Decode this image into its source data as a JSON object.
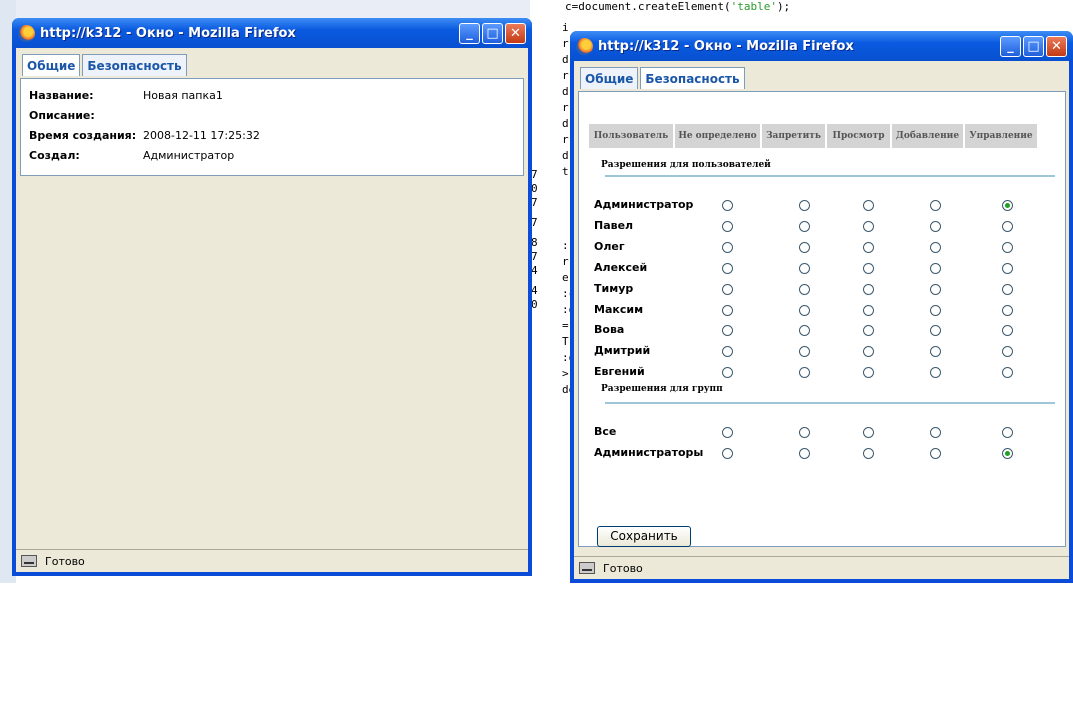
{
  "background": {
    "code_top": "c=document.createElement('table');",
    "code_fragment_prefix": "c=document.createElement(",
    "code_fragment_string": "'table'",
    "code_fragment_suffix": ");",
    "code_lines": [
      "i",
      "r",
      "d",
      "r",
      "d",
      "r",
      "d",
      "r",
      "d",
      "t'"
    ],
    "code_lines_lower": [
      ":",
      "r",
      "e",
      ":c",
      "",
      "",
      ":o",
      "=",
      "T",
      "",
      ":o",
      ">",
      "de"
    ],
    "numbers": [
      "7",
      "0",
      "7",
      "7",
      "8",
      "7",
      "4",
      "4",
      "0"
    ]
  },
  "left_window": {
    "title": "http://k312 - Окно - Mozilla Firefox",
    "tabs": [
      "Общие",
      "Безопасность"
    ],
    "props": [
      {
        "label": "Название:",
        "value": "Новая папка1"
      },
      {
        "label": "Описание:",
        "value": ""
      },
      {
        "label": "Время создания:",
        "value": "2008-12-11 17:25:32"
      },
      {
        "label": "Создал:",
        "value": "Администратор"
      }
    ],
    "status": "Готово"
  },
  "right_window": {
    "title": "http://k312 - Окно - Mozilla Firefox",
    "tabs": [
      "Общие",
      "Безопасность"
    ],
    "columns": [
      "Пользователь",
      "Не определено",
      "Запретить",
      "Просмотр",
      "Добавление",
      "Управление"
    ],
    "users_section": "Разрешения для пользователей",
    "users": [
      {
        "name": "Администратор",
        "selected": 4
      },
      {
        "name": "Павел",
        "selected": -1
      },
      {
        "name": "Олег",
        "selected": -1
      },
      {
        "name": "Алексей",
        "selected": -1
      },
      {
        "name": "Тимур",
        "selected": -1
      },
      {
        "name": "Максим",
        "selected": -1
      },
      {
        "name": "Вова",
        "selected": -1
      },
      {
        "name": "Дмитрий",
        "selected": -1
      },
      {
        "name": "Евгений",
        "selected": -1
      }
    ],
    "groups_section": "Разрешения для групп",
    "groups": [
      {
        "name": "Все",
        "selected": -1
      },
      {
        "name": "Администраторы",
        "selected": 4
      }
    ],
    "save_label": "Сохранить",
    "status": "Готово"
  },
  "colors": {
    "title_blue": "#0a5ae0",
    "close_red": "#c23a14",
    "tab_text": "#1b57a8",
    "radio_checked": "#21a121"
  }
}
